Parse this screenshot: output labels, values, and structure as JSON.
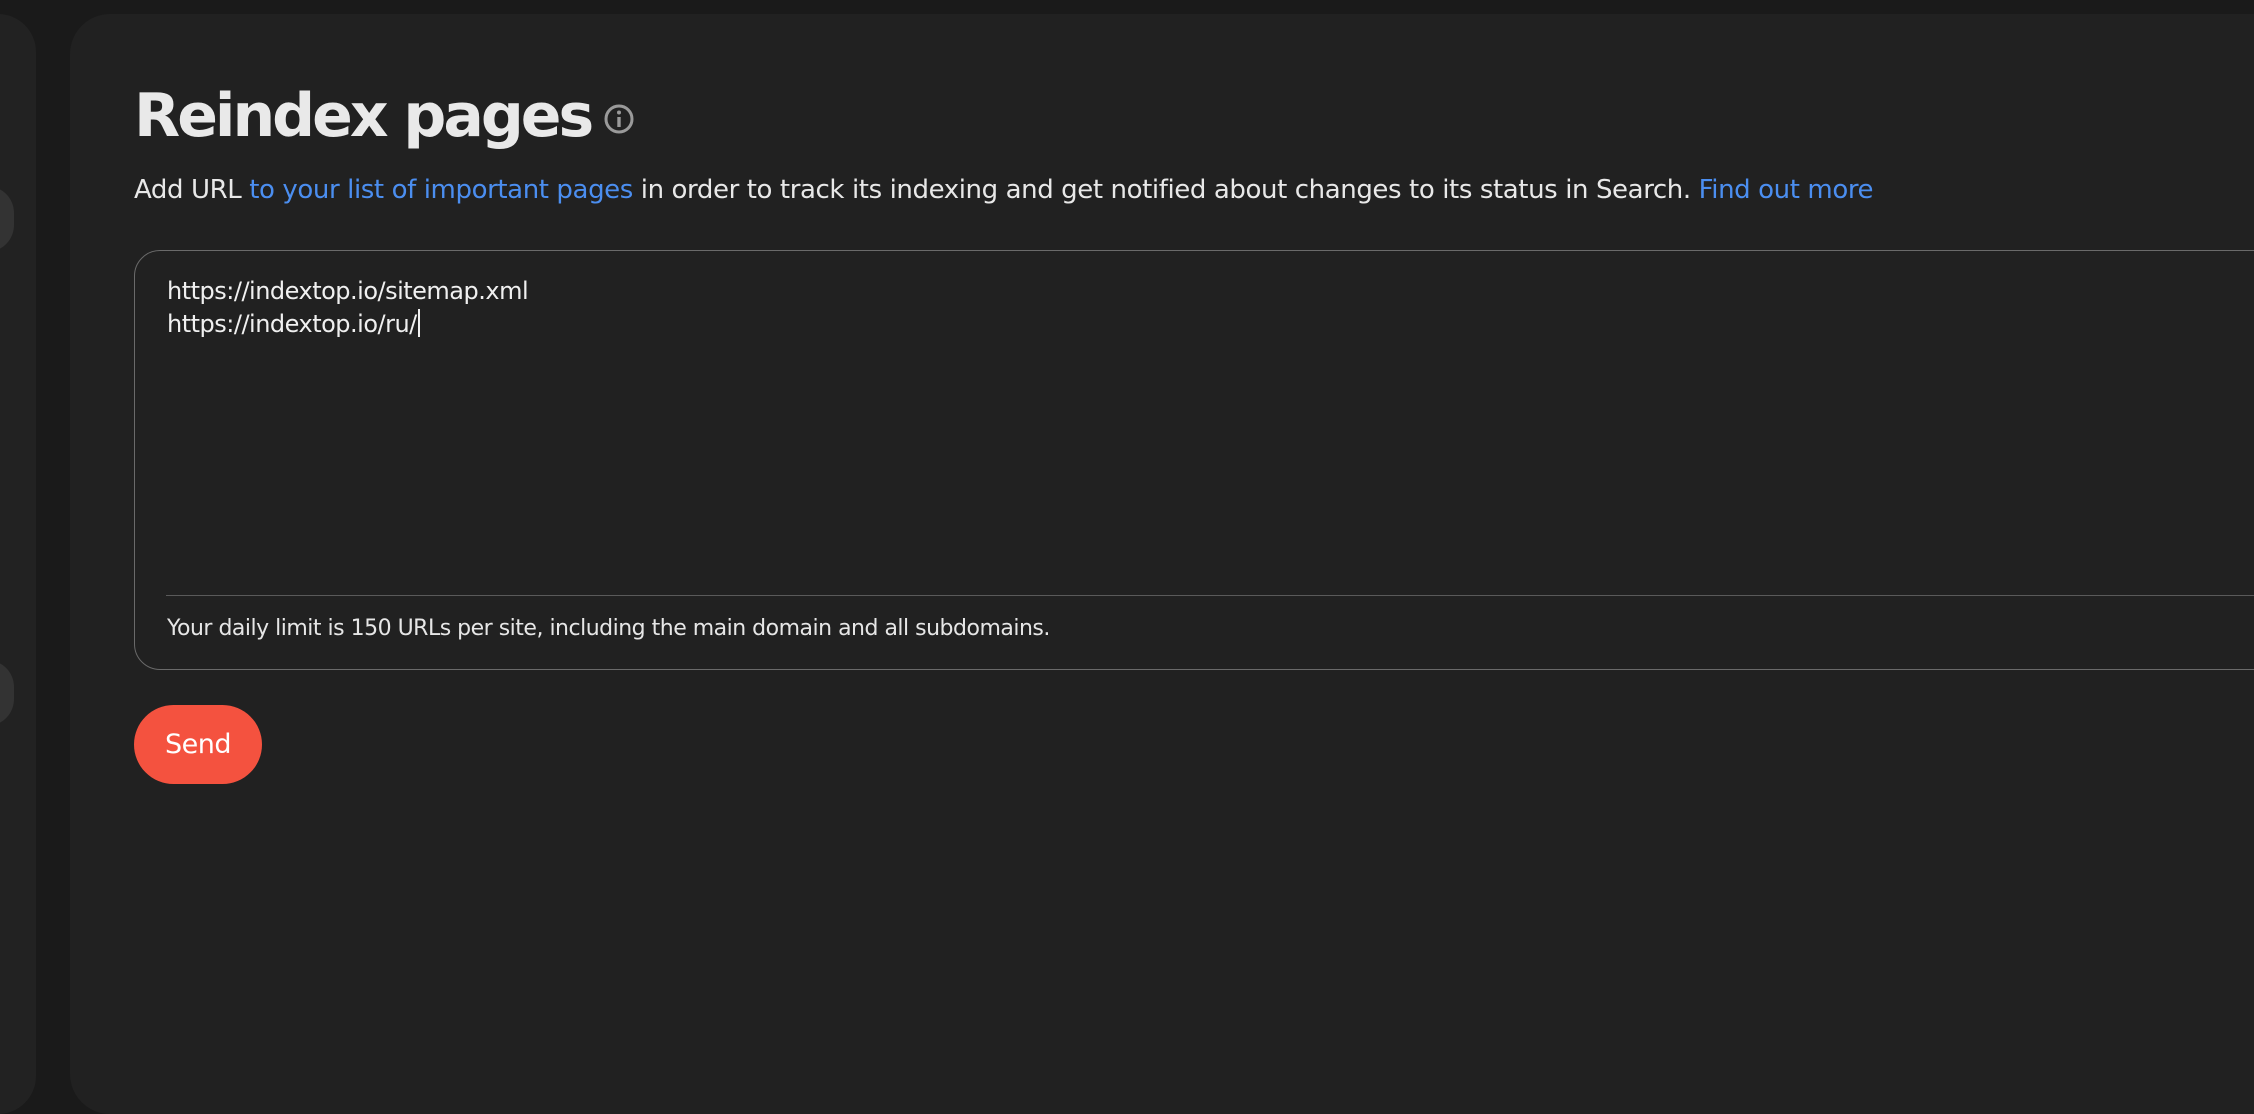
{
  "header": {
    "title": "Reindex pages",
    "info_icon": "info-circle-icon"
  },
  "description": {
    "prefix": "Add URL ",
    "link_important": "to your list of important pages",
    "middle": " in order to track its indexing and get notified about changes to its status in Search. ",
    "link_more": "Find out more"
  },
  "url_box": {
    "lines": [
      "https://indextop.io/sitemap.xml",
      "https://indextop.io/ru/"
    ],
    "limit_note": "Your daily limit is 150 URLs per site, including the main domain and all subdomains."
  },
  "actions": {
    "send_label": "Send"
  },
  "colors": {
    "accent": "#f4523f",
    "link": "#4b8ef0",
    "background": "#212121"
  }
}
